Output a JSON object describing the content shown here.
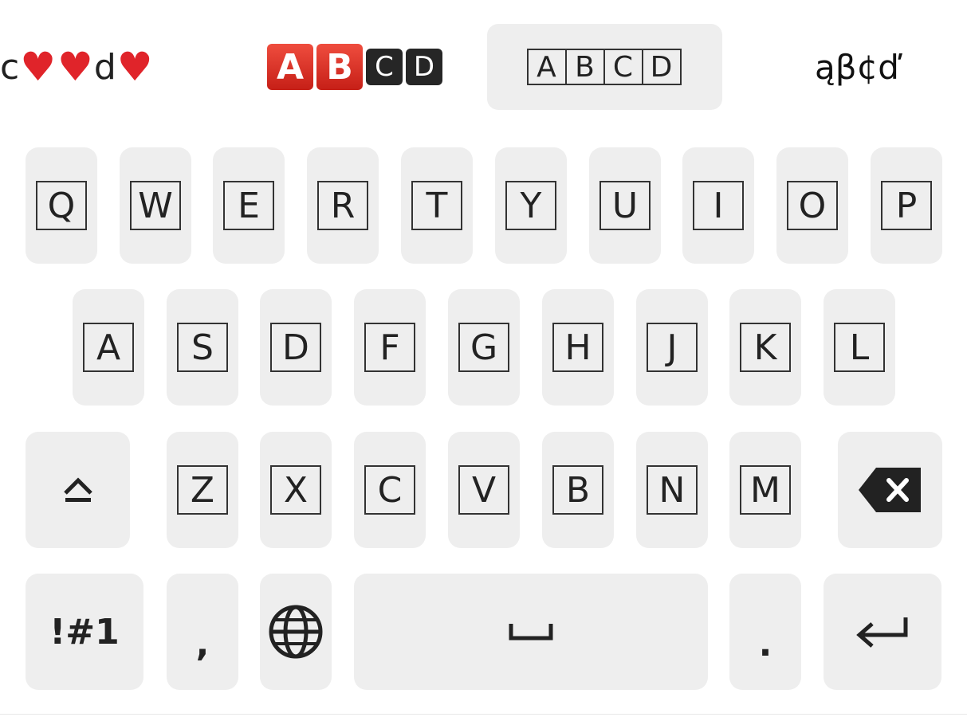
{
  "suggestions": {
    "hearts": {
      "prefix": "c",
      "middle": "d"
    },
    "emoji_letters": {
      "red": [
        "A",
        "B"
      ],
      "black": [
        "C",
        "D"
      ]
    },
    "boxed": [
      "A",
      "B",
      "C",
      "D"
    ],
    "fancy": "ąβ¢ď"
  },
  "keyboard": {
    "row1": [
      "Q",
      "W",
      "E",
      "R",
      "T",
      "Y",
      "U",
      "I",
      "O",
      "P"
    ],
    "row2": [
      "A",
      "S",
      "D",
      "F",
      "G",
      "H",
      "J",
      "K",
      "L"
    ],
    "row3": [
      "Z",
      "X",
      "C",
      "V",
      "B",
      "N",
      "M"
    ],
    "symbols_label": "!#1",
    "comma": ",",
    "period": "."
  },
  "icons": {
    "shift": "shift-icon",
    "backspace": "backspace-icon",
    "globe": "globe-icon",
    "space": "space-bar-icon",
    "enter": "enter-icon"
  },
  "colors": {
    "key_bg": "#eeeeee",
    "heart": "#e0242a",
    "red_block": "#d9342a",
    "black_block": "#262626"
  }
}
